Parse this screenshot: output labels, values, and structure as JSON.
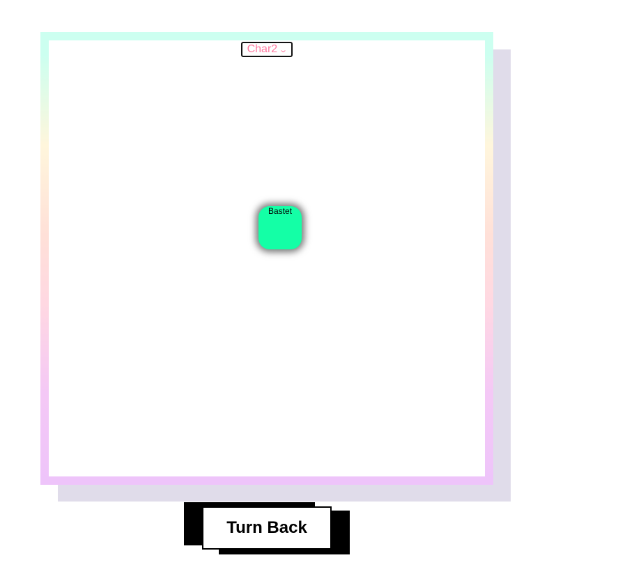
{
  "character_select": {
    "selected": "Char2",
    "icon": "chevron-down-icon"
  },
  "character": {
    "name": "Bastet",
    "color": "#14ffa6"
  },
  "button": {
    "label": "Turn Back"
  }
}
